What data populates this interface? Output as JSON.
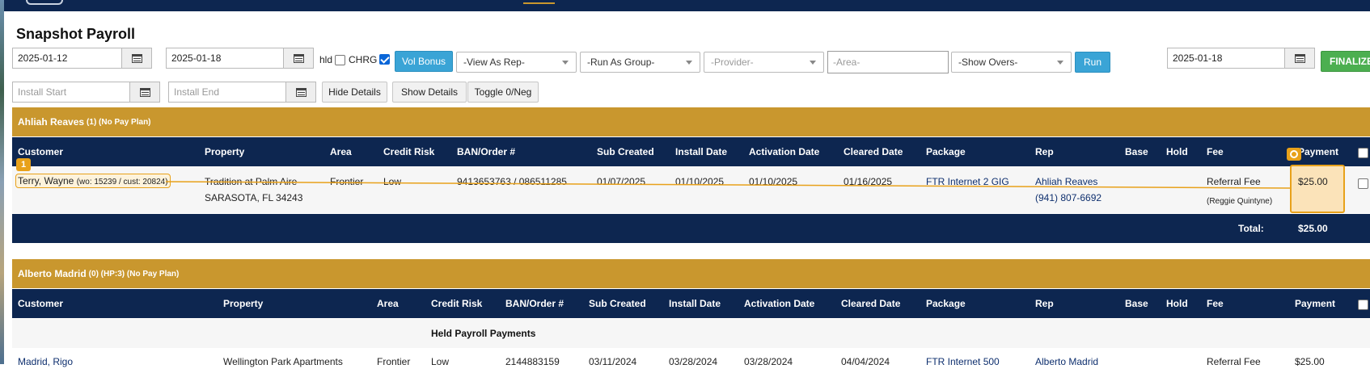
{
  "page": {
    "title": "Snapshot Payroll"
  },
  "filters": {
    "start_date": "2025-01-12",
    "end_date": "2025-01-18",
    "hld_label": "hld",
    "hld_checked": false,
    "chrg_label": "CHRG",
    "chrg_checked": true,
    "vol_bonus_label": "Vol Bonus",
    "view_as_rep": "-View As Rep-",
    "run_as_group": "-Run As Group-",
    "provider": "-Provider-",
    "area_placeholder": "-Area-",
    "show_overs": "-Show Overs-",
    "run_label": "Run",
    "finalize_date": "2025-01-18",
    "finalize_label": "FINALIZE",
    "install_start_placeholder": "Install Start",
    "install_end_placeholder": "Install End",
    "hide_details_label": "Hide Details",
    "show_details_label": "Show Details",
    "toggle_label": "Toggle 0/Neg"
  },
  "sections": [
    {
      "name": "Ahliah Reaves",
      "meta": "(1) (No Pay Plan)",
      "columns": [
        "Customer",
        "Property",
        "Area",
        "Credit Risk",
        "BAN/Order #",
        "Sub Created",
        "Install Date",
        "Activation Date",
        "Cleared Date",
        "Package",
        "Rep",
        "Base",
        "Hold",
        "Fee",
        "Payment"
      ],
      "rows": [
        {
          "customer": "Terry, Wayne",
          "customer_ids": "(wo: 15239 / cust: 20824)",
          "property_line1": "Tradition at Palm Aire",
          "property_line2": "SARASOTA, FL 34243",
          "area": "Frontier",
          "credit_risk": "Low",
          "ban_order": "9413653763 / 086511285",
          "sub_created": "01/07/2025",
          "install_date": "01/10/2025",
          "activation_date": "01/10/2025",
          "cleared_date": "01/16/2025",
          "package": "FTR Internet 2 GIG",
          "rep": "Ahliah Reaves",
          "rep_phone": "(941) 807-6692",
          "fee": "Referral Fee",
          "fee_sub": "(Reggie Quintyne)",
          "payment": "$25.00"
        }
      ],
      "total_label": "Total:",
      "total_value": "$25.00"
    },
    {
      "name": "Alberto Madrid",
      "meta": "(0) (HP:3) (No Pay Plan)",
      "columns": [
        "Customer",
        "Property",
        "Area",
        "Credit Risk",
        "BAN/Order #",
        "Sub Created",
        "Install Date",
        "Activation Date",
        "Cleared Date",
        "Package",
        "Rep",
        "Base",
        "Hold",
        "Fee",
        "Payment"
      ],
      "held_label": "Held Payroll Payments",
      "partial_row": {
        "customer": "Madrid, Rigo",
        "property": "Wellington Park Apartments",
        "area": "Frontier",
        "credit_risk": "Low",
        "ban_order": "2144883159",
        "sub_created": "03/11/2024",
        "install_date": "03/28/2024",
        "activation_date": "03/28/2024",
        "cleared_date": "04/04/2024",
        "package": "FTR Internet 500",
        "rep": "Alberto Madrid",
        "fee": "Referral Fee",
        "payment": "$25.00"
      }
    }
  ],
  "overlay": {
    "anchor_badge": "1"
  }
}
